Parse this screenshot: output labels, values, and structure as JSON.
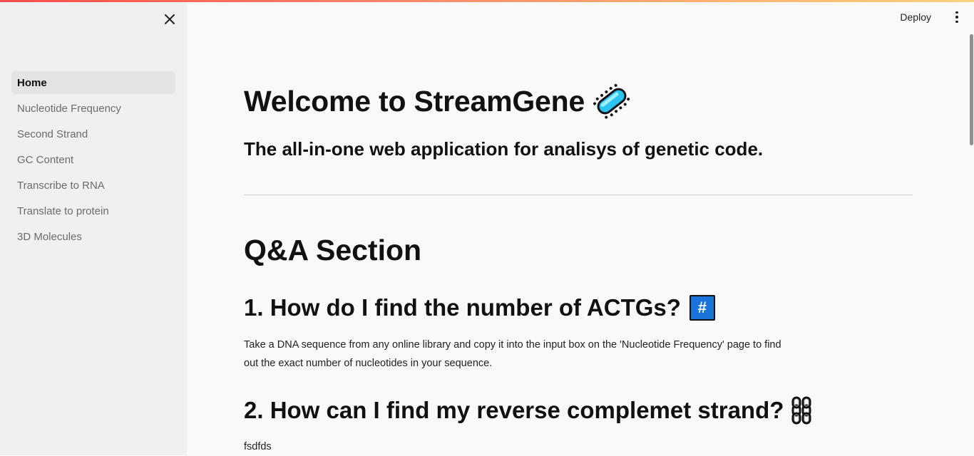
{
  "sidebar": {
    "close_icon": "close-icon",
    "items": [
      {
        "label": "Home",
        "active": true
      },
      {
        "label": "Nucleotide Frequency",
        "active": false
      },
      {
        "label": "Second Strand",
        "active": false
      },
      {
        "label": "GC Content",
        "active": false
      },
      {
        "label": "Transcribe to RNA",
        "active": false
      },
      {
        "label": "Translate to protein",
        "active": false
      },
      {
        "label": "3D Molecules",
        "active": false
      }
    ]
  },
  "header": {
    "deploy_label": "Deploy",
    "menu_icon": "kebab-menu-icon"
  },
  "main": {
    "title": "Welcome to StreamGene",
    "title_icon": "microbe-icon",
    "subtitle": "The all-in-one web application for analisys of genetic code.",
    "section_title": "Q&A Section",
    "questions": [
      {
        "question": "1. How do I find the number of ACTGs?",
        "icon": "hash-icon",
        "icon_glyph": "#",
        "answer": "Take a DNA sequence from any online library and copy it into the input box on the 'Nucleotide Frequency' page to find out the exact number of nucleotides in your sequence."
      },
      {
        "question": "2. How can I find my reverse complemet strand?",
        "icon": "chain-icon",
        "answer": "fsdfds"
      }
    ]
  },
  "colors": {
    "accent_gradient_start": "#ff4b4b",
    "accent_gradient_end": "#ffd37a",
    "sidebar_bg": "#f0f0f0",
    "main_bg": "#f9f9f9",
    "hash_icon_bg": "#1a73d9"
  }
}
